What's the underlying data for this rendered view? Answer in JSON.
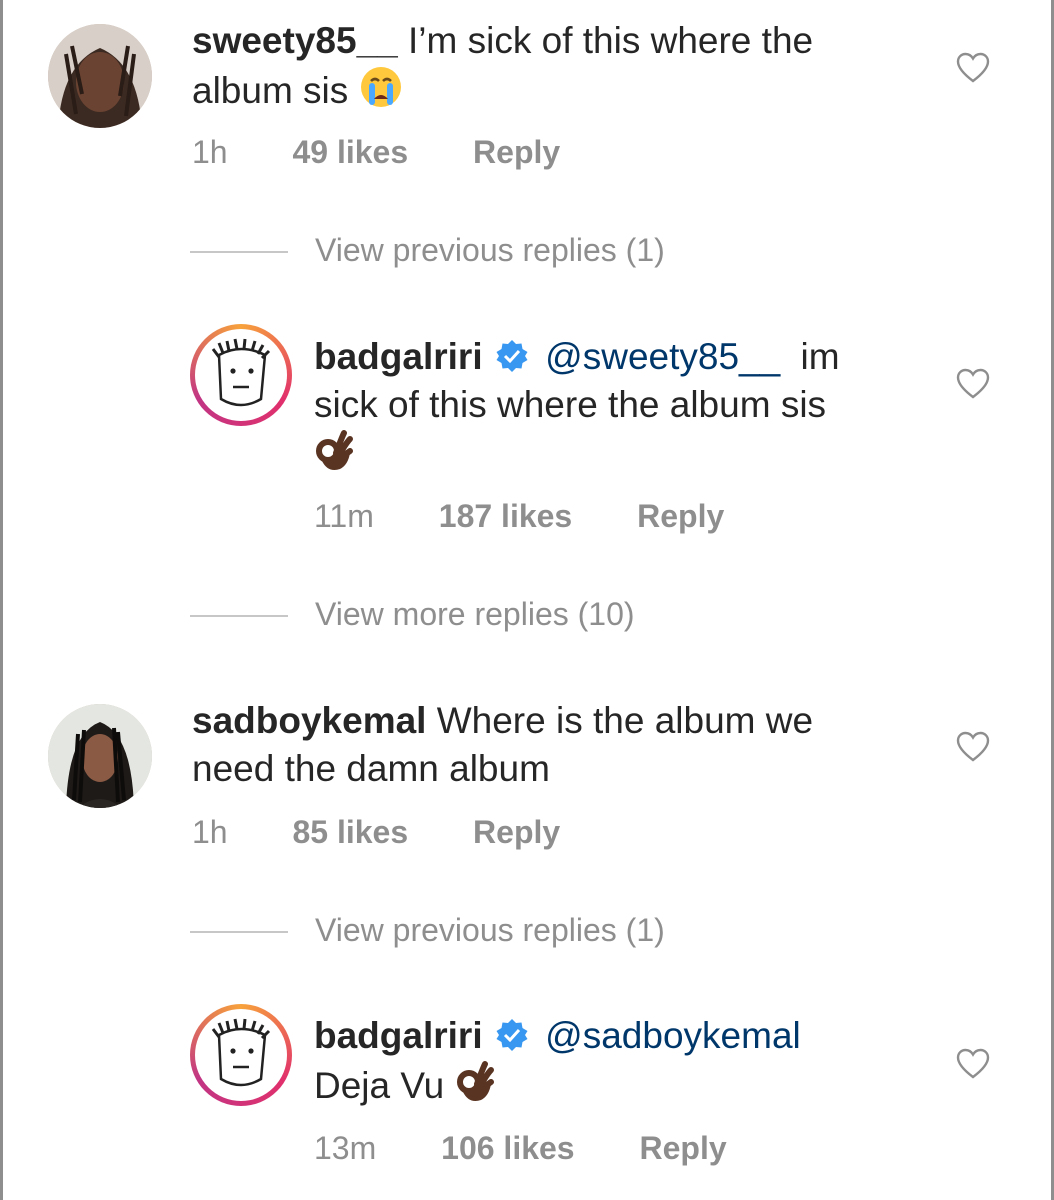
{
  "comments": [
    {
      "username": "sweety85__",
      "text_line1": "I’m sick of this where the",
      "text_line2": "album sis",
      "emoji": "crying-face",
      "time": "1h",
      "likes": "49 likes",
      "reply": "Reply"
    },
    {
      "username": "badgalriri",
      "verified": true,
      "mention": "@sweety85__",
      "text_line1_rest": "im",
      "text_line2": "sick of this where the album sis",
      "emoji": "ok-hand",
      "time": "11m",
      "likes": "187 likes",
      "reply": "Reply"
    },
    {
      "username": "sadboykemal",
      "text_line1": "Where is the album we",
      "text_line2": "need the damn album",
      "time": "1h",
      "likes": "85 likes",
      "reply": "Reply"
    },
    {
      "username": "badgalriri",
      "verified": true,
      "mention": "@sadboykemal",
      "text_line2": "Deja Vu",
      "emoji": "ok-hand",
      "time": "13m",
      "likes": "106 likes",
      "reply": "Reply"
    }
  ],
  "view_rows": [
    "View previous replies (1)",
    "View more replies (10)",
    "View previous replies (1)"
  ],
  "colors": {
    "text": "#262626",
    "meta": "#8e8e8e",
    "mention": "#00376b",
    "verified": "#3897f0"
  }
}
